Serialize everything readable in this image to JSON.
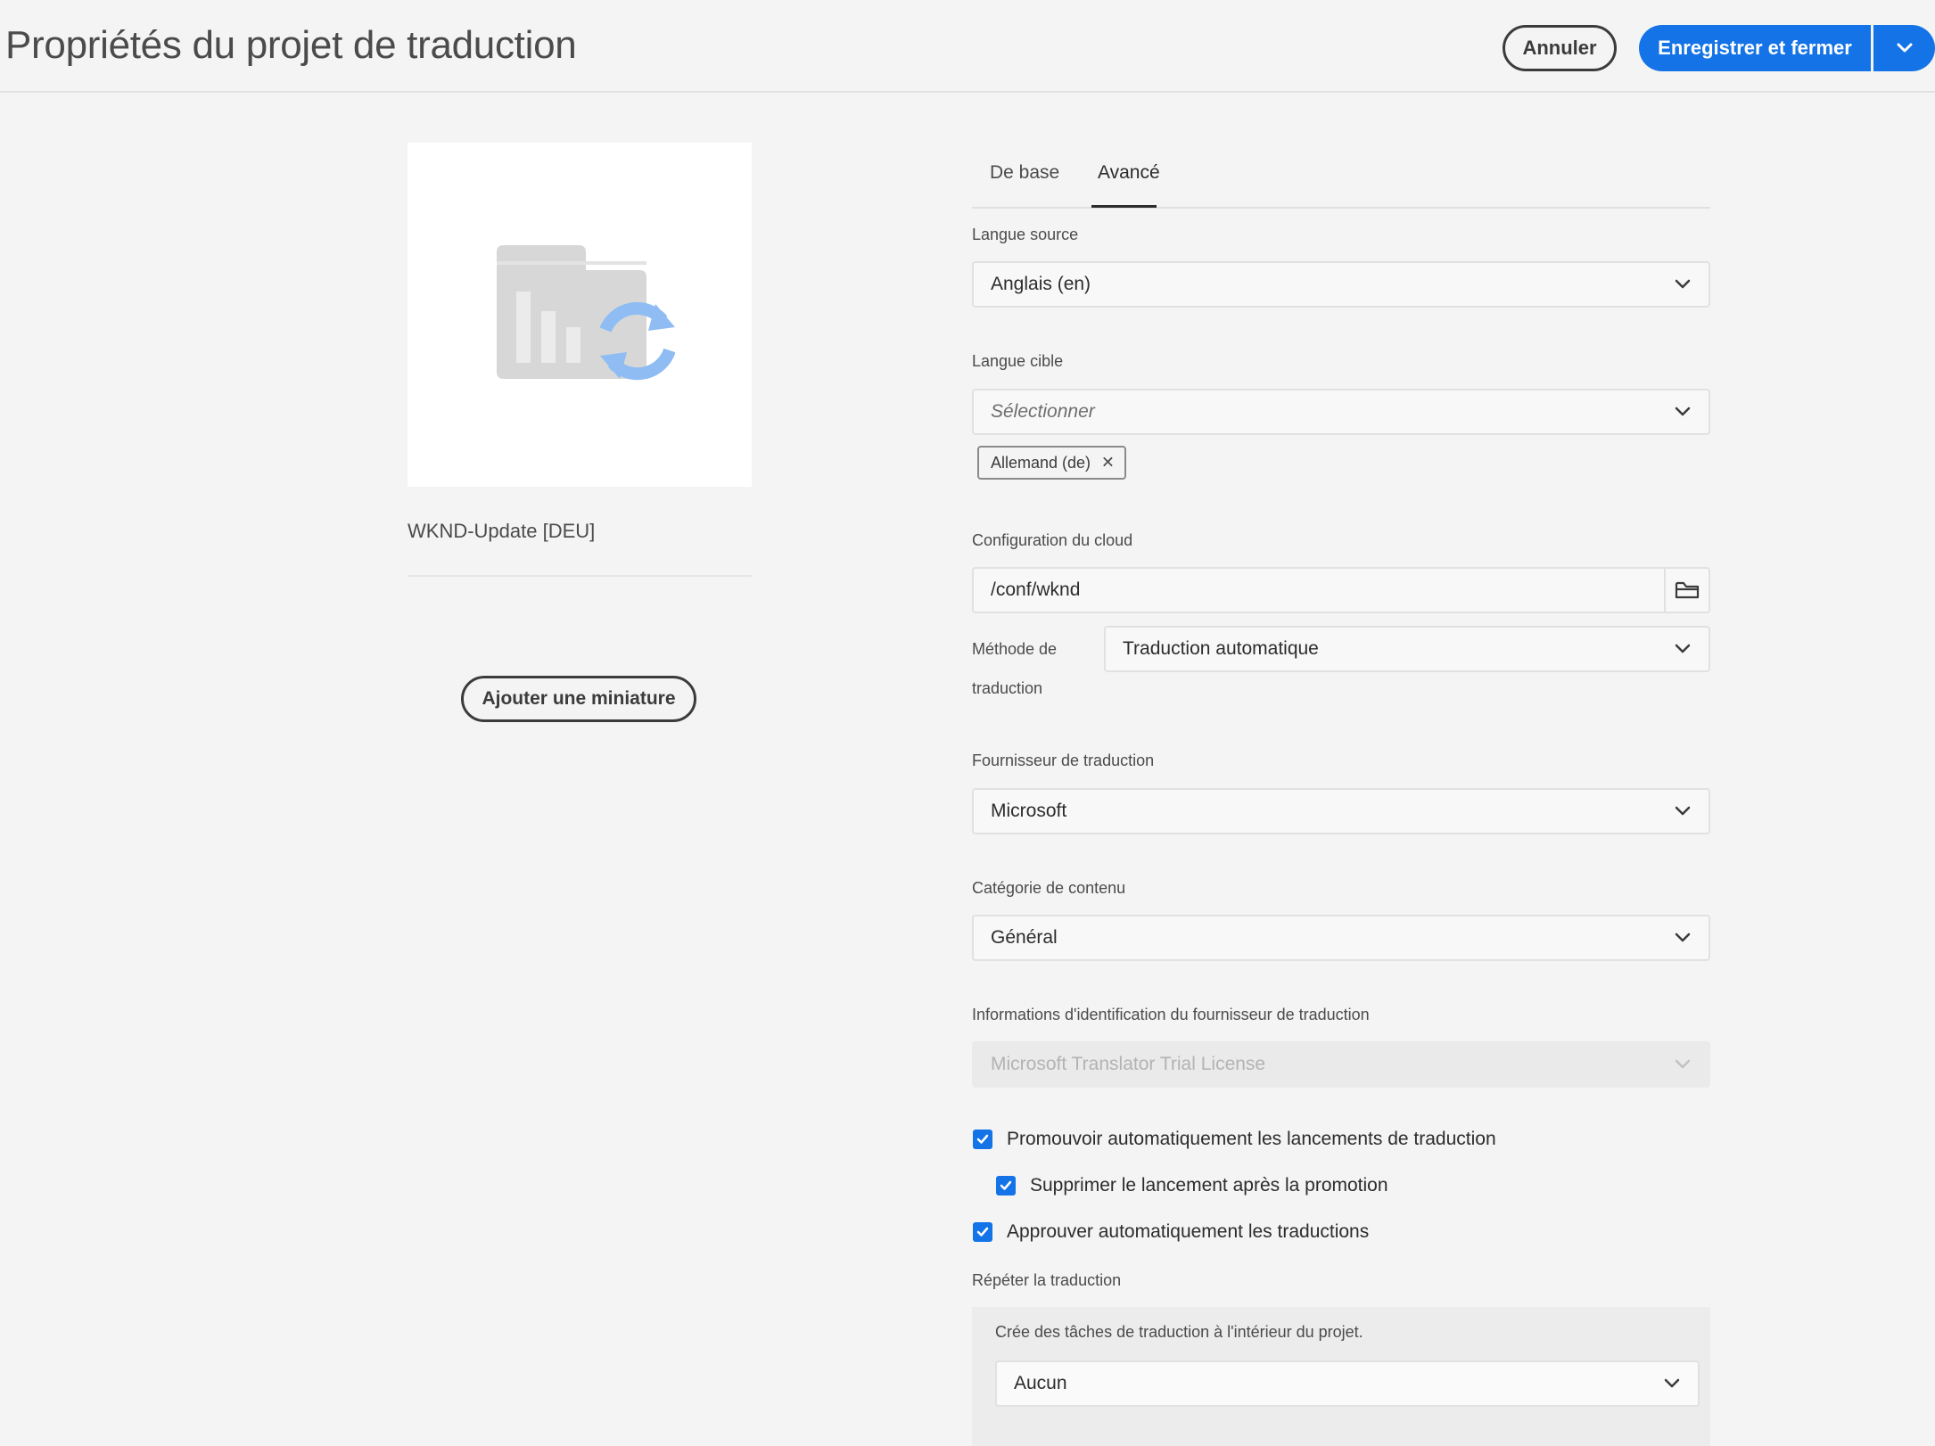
{
  "header": {
    "title": "Propriétés du projet de traduction",
    "cancel_label": "Annuler",
    "save_label": "Enregistrer et fermer"
  },
  "project": {
    "name": "WKND-Update [DEU]",
    "add_thumbnail_label": "Ajouter une miniature"
  },
  "tabs": [
    {
      "label": "De base",
      "active": false
    },
    {
      "label": "Avancé",
      "active": true
    }
  ],
  "form": {
    "source_language": {
      "label": "Langue source",
      "value": "Anglais (en)"
    },
    "target_language": {
      "label": "Langue cible",
      "placeholder": "Sélectionner",
      "tags": [
        "Allemand (de)"
      ]
    },
    "cloud_config": {
      "label": "Configuration du cloud",
      "value": "/conf/wknd"
    },
    "translation_method": {
      "label_line1": "Méthode de",
      "label_line2": "traduction",
      "value": "Traduction automatique"
    },
    "provider": {
      "label": "Fournisseur de traduction",
      "value": "Microsoft"
    },
    "content_category": {
      "label": "Catégorie de contenu",
      "value": "Général"
    },
    "credentials": {
      "label": "Informations d'identification du fournisseur de traduction",
      "value": "Microsoft Translator Trial License",
      "disabled": true
    },
    "checkboxes": [
      {
        "label": "Promouvoir automatiquement les lancements de traduction",
        "checked": true
      },
      {
        "label": "Supprimer le lancement après la promotion",
        "checked": true
      },
      {
        "label": "Approuver automatiquement les traductions",
        "checked": true
      }
    ],
    "repeat": {
      "label": "Répéter la traduction",
      "description": "Crée des tâches de traduction à l'intérieur du projet.",
      "value": "Aucun"
    }
  },
  "colors": {
    "accent": "#1473e6",
    "background": "#f4f4f4"
  },
  "icons": [
    "chevron-down-icon",
    "folder-icon",
    "close-icon",
    "checkmark-icon",
    "translation-project-icon"
  ]
}
